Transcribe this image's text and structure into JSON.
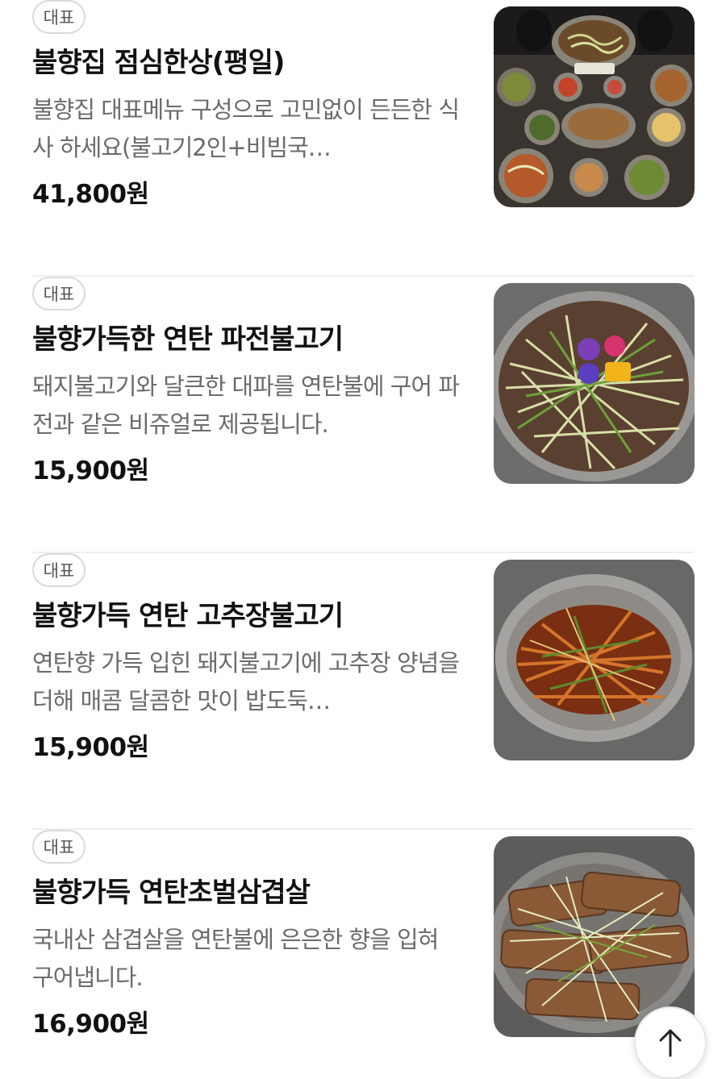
{
  "menu": {
    "items": [
      {
        "badge": "대표",
        "name": "불향집 점심한상(평일)",
        "description": "불향집 대표메뉴 구성으로 고민없이 든든한 식사 하세요(불고기2인+비빔국…",
        "price": "41,800원",
        "image_icon": "lunch-set-photo"
      },
      {
        "badge": "대표",
        "name": "불향가득한 연탄 파전불고기",
        "description": "돼지불고기와 달큰한 대파를 연탄불에 구어 파전과 같은 비쥬얼로 제공됩니다.",
        "price": "15,900원",
        "image_icon": "green-onion-bulgogi-photo"
      },
      {
        "badge": "대표",
        "name": "불향가득 연탄 고추장불고기",
        "description": "연탄향 가득 입힌 돼지불고기에 고추장 양념을 더해 매콤 달콤한 맛이 밥도둑…",
        "price": "15,900원",
        "image_icon": "gochujang-bulgogi-photo"
      },
      {
        "badge": "대표",
        "name": "불향가득 연탄초벌삼겹살",
        "description": "국내산 삼겹살을 연탄불에 은은한 향을 입혀 구어냅니다.",
        "price": "16,900원",
        "image_icon": "samgyeopsal-photo"
      }
    ]
  },
  "scroll_top_icon": "arrow-up-icon",
  "colors": {
    "text_primary": "#111111",
    "text_secondary": "#6b6b6b",
    "badge_border": "#dadada",
    "divider": "#efefef"
  }
}
